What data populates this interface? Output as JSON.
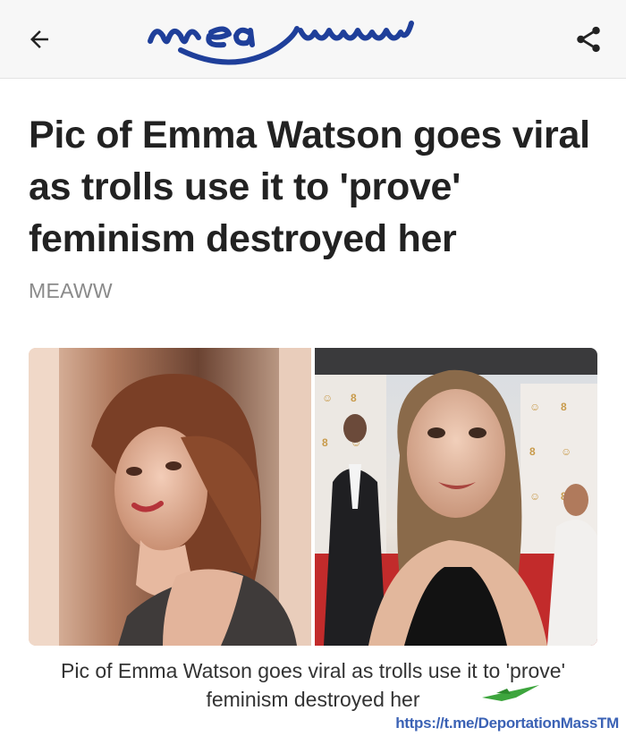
{
  "app": {
    "logo_text": "meaww",
    "colors": {
      "brand": "#1f3f9a",
      "topbar_bg": "#f7f7f7",
      "source_text": "#8a8a8a",
      "watermark": "#3b62b5"
    }
  },
  "toolbar": {
    "back_icon": "arrow-left-icon",
    "share_icon": "share-icon"
  },
  "article": {
    "headline": "Pic of Emma Watson goes viral as trolls use it to 'prove' feminism destroyed her",
    "source": "MEAWW",
    "caption": "Pic of Emma Watson goes viral as trolls use it to 'prove' feminism destroyed her"
  },
  "watermark": {
    "text": "https://t.me/DeportationMassTM"
  }
}
